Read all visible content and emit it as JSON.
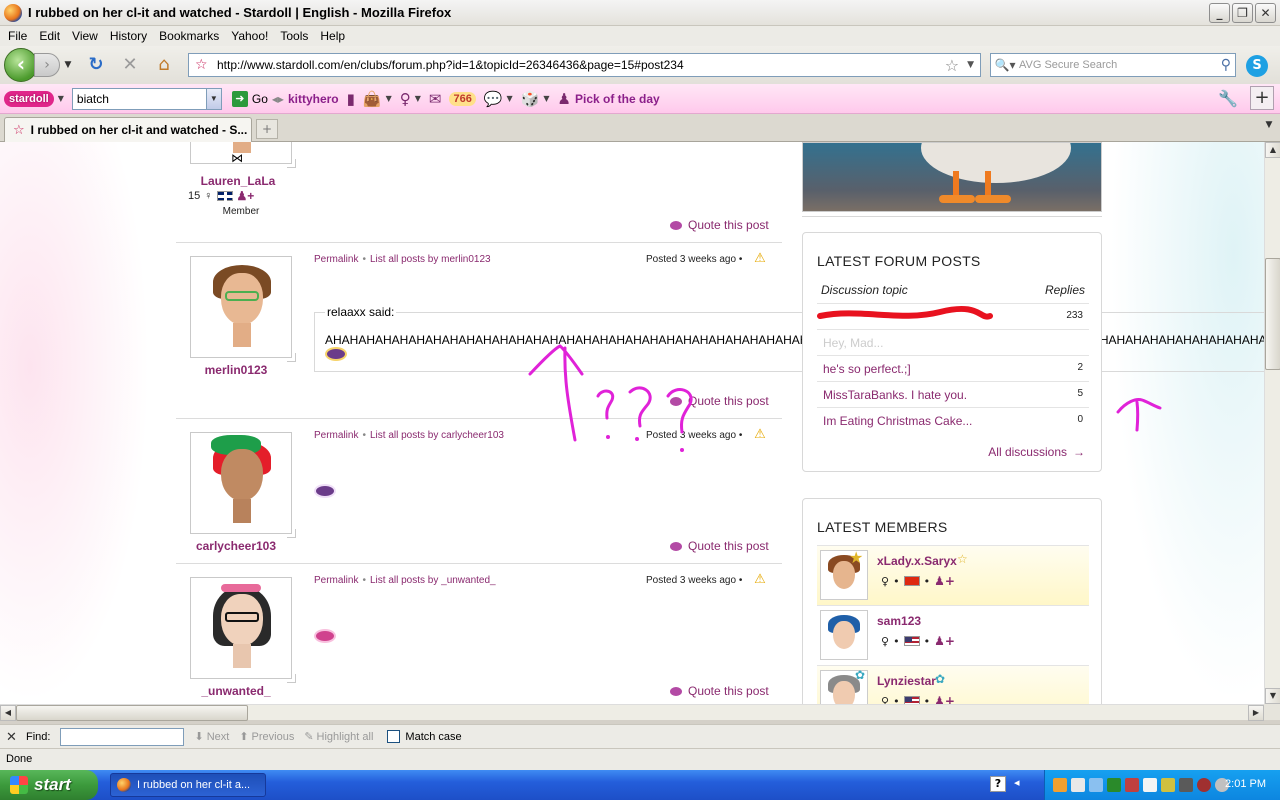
{
  "window": {
    "title": "I rubbed on her cl-it and watched - Stardoll | English - Mozilla Firefox",
    "controls": [
      "_",
      "❐",
      "✕"
    ]
  },
  "menu": [
    "File",
    "Edit",
    "View",
    "History",
    "Bookmarks",
    "Yahoo!",
    "Tools",
    "Help"
  ],
  "nav": {
    "url": "http://www.stardoll.com/en/clubs/forum.php?id=1&topicId=26346436&page=15#post234",
    "search_placeholder": "AVG Secure Search"
  },
  "stardoll_toolbar": {
    "logo": "stardoll",
    "search_value": "biatch",
    "go_label": "Go",
    "username": "kittyhero",
    "count_badge": "766",
    "pick_label": "Pick of the day"
  },
  "tab": {
    "label": "I rubbed on her cl-it and watched - S..."
  },
  "posts": [
    {
      "user": "Lauren_LaLa",
      "meta": "15",
      "role": "Member",
      "quote_label": "Quote this post"
    },
    {
      "user": "merlin0123",
      "permalink": "Permalink",
      "list_posts": "List all posts by merlin0123",
      "posted": "Posted 3 weeks ago",
      "quote_author": "relaaxx said:",
      "quote_text": "AHAHAHAHAHAHAHAHAHAHAHAHAHAHAHAHAHAHAHAHAHAHAHAHAHAHAHAHAHAHAHAHAHAHAHAHAHAHAHAHAHAHAHAHAHAHAHAHAHAHAHAHAHAHAHAHAHAHAHAHAHAHAHAHAHAHAHAHAHAHAHA",
      "quote_label": "Quote this post"
    },
    {
      "user": "carlycheer103",
      "permalink": "Permalink",
      "list_posts": "List all posts by carlycheer103",
      "posted": "Posted 3 weeks ago",
      "quote_label": "Quote this post"
    },
    {
      "user": "_unwanted_",
      "permalink": "Permalink",
      "list_posts": "List all posts by _unwanted_",
      "posted": "Posted 3 weeks ago",
      "quote_label": "Quote this post"
    }
  ],
  "latest_forum_posts": {
    "title": "LATEST FORUM POSTS",
    "col_topic": "Discussion topic",
    "col_replies": "Replies",
    "rows": [
      {
        "topic": "",
        "replies": "233"
      },
      {
        "topic": "Hey, Mad...",
        "replies": ""
      },
      {
        "topic": "he's so perfect.;]",
        "replies": "2"
      },
      {
        "topic": "MissTaraBanks. I hate you.",
        "replies": "5"
      },
      {
        "topic": "Im Eating Christmas Cake...",
        "replies": "0"
      }
    ],
    "all_label": "All discussions"
  },
  "latest_members": {
    "title": "LATEST MEMBERS",
    "members": [
      {
        "name": "xLady.x.Saryx"
      },
      {
        "name": "sam123"
      },
      {
        "name": "Lynziestar"
      }
    ]
  },
  "findbar": {
    "label": "Find:",
    "next": "Next",
    "previous": "Previous",
    "highlight": "Highlight all",
    "match_case": "Match case"
  },
  "status": "Done",
  "taskbar": {
    "start": "start",
    "task_label": "I rubbed on her cl-it a...",
    "clock": "2:01 PM"
  },
  "colors": {
    "link": "#8a2a6f",
    "doodle": "#e022d8",
    "stardoll_pink": "#ffc9ec"
  }
}
